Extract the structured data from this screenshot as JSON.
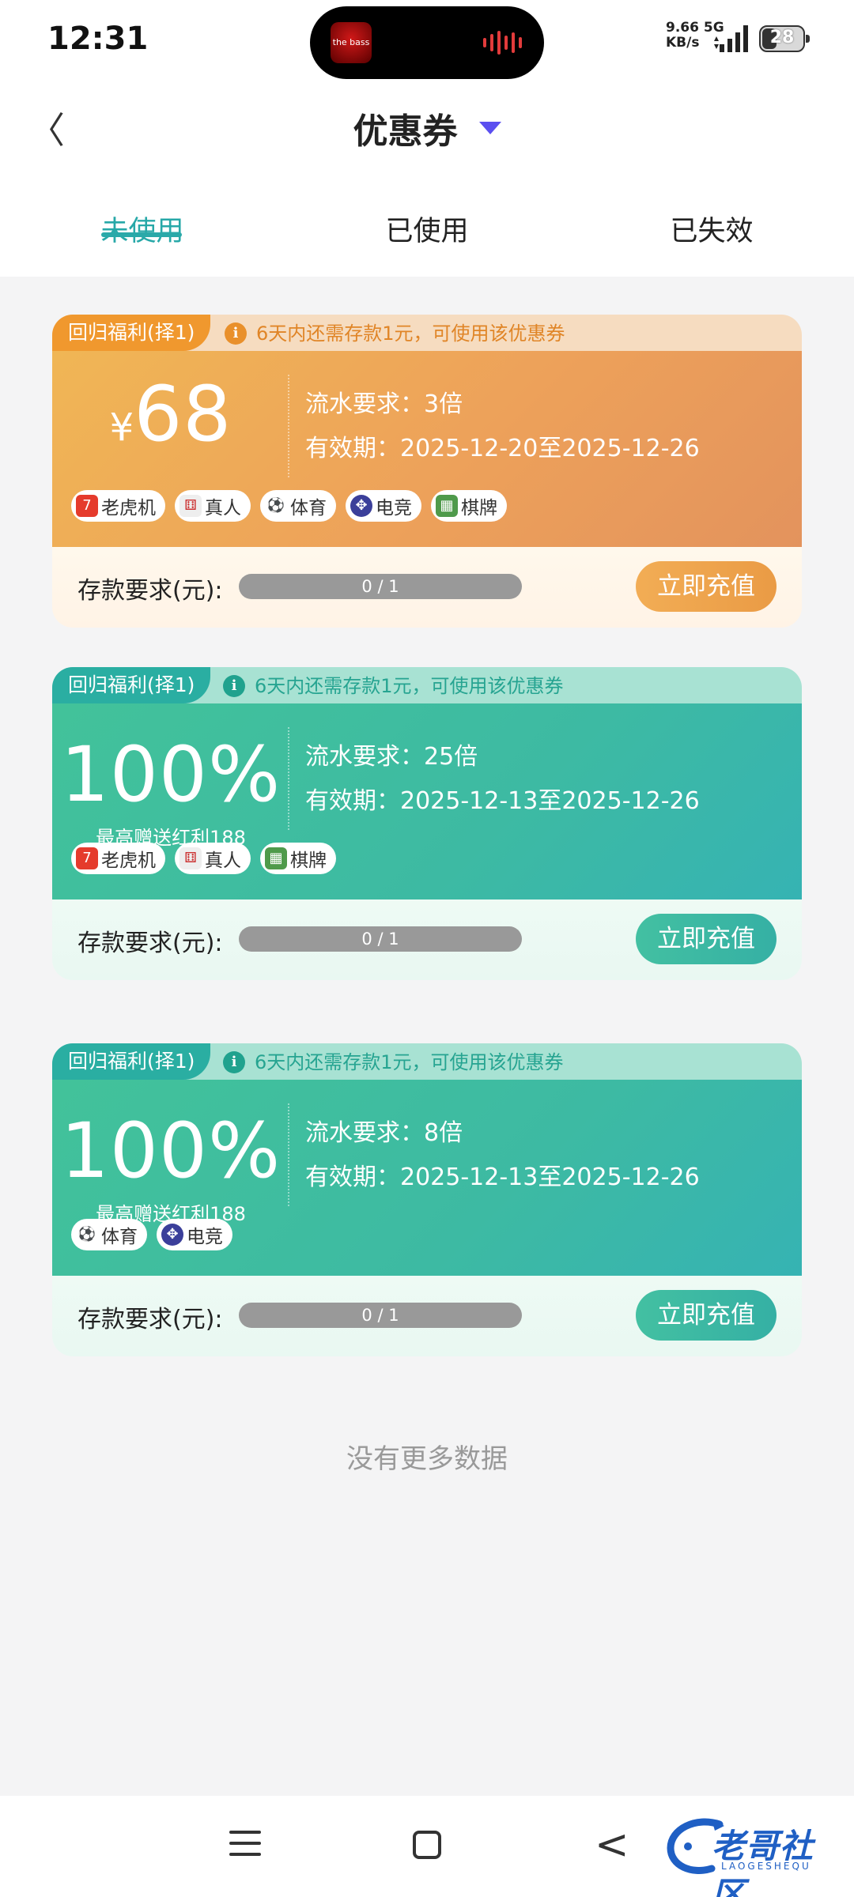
{
  "status_bar": {
    "time": "12:31",
    "now_playing_label": "the bass",
    "net_speed_value": "9.66",
    "net_speed_unit": "KB/s",
    "network_type": "5G",
    "battery_level": "28"
  },
  "header": {
    "title": "优惠券",
    "back_icon": "chevron-left-icon",
    "dropdown_icon": "caret-down-icon",
    "accent_color": "#5b4ff0"
  },
  "tabs": [
    {
      "label": "未使用",
      "active": true
    },
    {
      "label": "已使用",
      "active": false
    },
    {
      "label": "已失效",
      "active": false
    }
  ],
  "coupons": [
    {
      "theme": "orange",
      "badge": "回归福利(择1)",
      "notice": "6天内还需存款1元，可使用该优惠券",
      "currency": "¥",
      "amount": "68",
      "sub": "",
      "wagering": "流水要求：3倍",
      "validity": "有效期：2025-12-20至2025-12-26",
      "tags": [
        "老虎机",
        "真人",
        "体育",
        "电竞",
        "棋牌"
      ],
      "deposit_label": "存款要求(元):",
      "progress": "0 / 1",
      "progress_value": 0,
      "cta": "立即充值"
    },
    {
      "theme": "green",
      "badge": "回归福利(择1)",
      "notice": "6天内还需存款1元，可使用该优惠券",
      "currency": "",
      "amount": "100%",
      "sub": "最高赠送红利188",
      "wagering": "流水要求：25倍",
      "validity": "有效期：2025-12-13至2025-12-26",
      "tags": [
        "老虎机",
        "真人",
        "棋牌"
      ],
      "deposit_label": "存款要求(元):",
      "progress": "0 / 1",
      "progress_value": 0,
      "cta": "立即充值"
    },
    {
      "theme": "green",
      "badge": "回归福利(择1)",
      "notice": "6天内还需存款1元，可使用该优惠券",
      "currency": "",
      "amount": "100%",
      "sub": "最高赠送红利188",
      "wagering": "流水要求：8倍",
      "validity": "有效期：2025-12-13至2025-12-26",
      "tags": [
        "体育",
        "电竞"
      ],
      "deposit_label": "存款要求(元):",
      "progress": "0 / 1",
      "progress_value": 0,
      "cta": "立即充值"
    }
  ],
  "empty_footer": "没有更多数据",
  "watermark": {
    "text": "老哥社区",
    "sub": "LAOGESHEQU"
  },
  "colors": {
    "tab_active": "#27a8a8",
    "orange_cta": "#ea9b45",
    "green_cta": "#35b0a4"
  }
}
